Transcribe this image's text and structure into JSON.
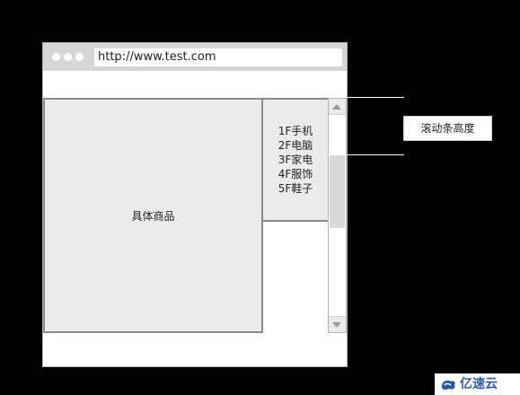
{
  "browser": {
    "url": "http://www.test.com"
  },
  "main": {
    "products_label": "具体商品"
  },
  "floor_nav": {
    "items": [
      {
        "label": "1F手机"
      },
      {
        "label": "2F电脑"
      },
      {
        "label": "3F家电"
      },
      {
        "label": "4F服饰"
      },
      {
        "label": "5F鞋子"
      }
    ]
  },
  "annotation": {
    "callout_label": "滚动条高度"
  },
  "watermark": {
    "text": "亿速云",
    "icon": "yisu-cloud-logo-icon"
  },
  "colors": {
    "background": "#000000",
    "titlebar": "#d6d6d6",
    "panel_fill": "#ebebeb",
    "panel_border": "#8a8a8a",
    "watermark_text": "#2b5ba8"
  }
}
